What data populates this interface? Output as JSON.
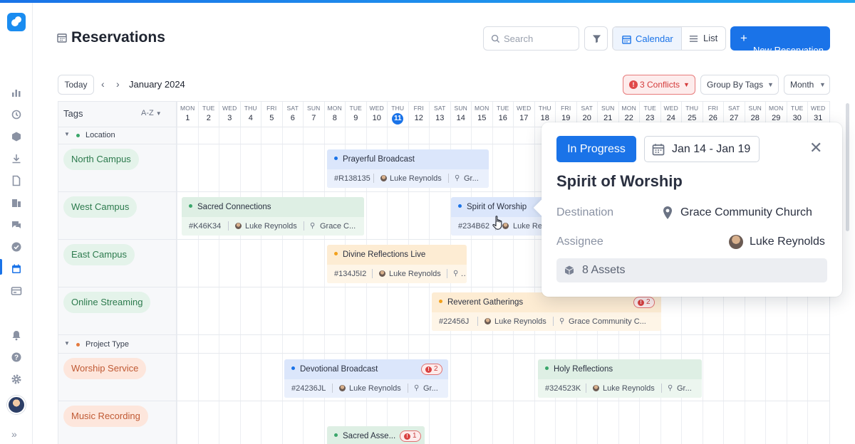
{
  "page": {
    "title": "Reservations"
  },
  "header": {
    "search_placeholder": "Search",
    "view_calendar_label": "Calendar",
    "view_list_label": "List",
    "new_reservation_label": "New Reservation"
  },
  "toolbar": {
    "today_label": "Today",
    "month_label": "January 2024",
    "conflicts_label": "3 Conflicts",
    "conflicts_icon_text": "!",
    "group_by_label": "Group By Tags",
    "range_label": "Month"
  },
  "grid": {
    "tags_header": "Tags",
    "sort_label": "A-Z",
    "today_day": 11,
    "days": [
      {
        "dow": "MON",
        "num": "1"
      },
      {
        "dow": "TUE",
        "num": "2"
      },
      {
        "dow": "WED",
        "num": "3"
      },
      {
        "dow": "THU",
        "num": "4"
      },
      {
        "dow": "FRI",
        "num": "5"
      },
      {
        "dow": "SAT",
        "num": "6"
      },
      {
        "dow": "SUN",
        "num": "7"
      },
      {
        "dow": "MON",
        "num": "8"
      },
      {
        "dow": "TUE",
        "num": "9"
      },
      {
        "dow": "WED",
        "num": "10"
      },
      {
        "dow": "THU",
        "num": "11"
      },
      {
        "dow": "FRI",
        "num": "12"
      },
      {
        "dow": "SAT",
        "num": "13"
      },
      {
        "dow": "SUN",
        "num": "14"
      },
      {
        "dow": "MON",
        "num": "15"
      },
      {
        "dow": "TUE",
        "num": "16"
      },
      {
        "dow": "WED",
        "num": "17"
      },
      {
        "dow": "THU",
        "num": "18"
      },
      {
        "dow": "FRI",
        "num": "19"
      },
      {
        "dow": "SAT",
        "num": "20"
      },
      {
        "dow": "SUN",
        "num": "21"
      },
      {
        "dow": "MON",
        "num": "22"
      },
      {
        "dow": "TUE",
        "num": "23"
      },
      {
        "dow": "WED",
        "num": "24"
      },
      {
        "dow": "THU",
        "num": "25"
      },
      {
        "dow": "FRI",
        "num": "26"
      },
      {
        "dow": "SAT",
        "num": "27"
      },
      {
        "dow": "SUN",
        "num": "28"
      },
      {
        "dow": "MON",
        "num": "29"
      },
      {
        "dow": "TUE",
        "num": "30"
      },
      {
        "dow": "WED",
        "num": "31"
      }
    ],
    "groups": [
      {
        "label": "Location",
        "color": "#3aa66a",
        "tags": [
          "North Campus",
          "West Campus",
          "East Campus",
          "Online Streaming"
        ]
      },
      {
        "label": "Project Type",
        "color": "#e47a3f",
        "tags": [
          "Worship Service",
          "Music Recording"
        ]
      }
    ]
  },
  "reservations": {
    "prayerful": {
      "title": "Prayerful Broadcast",
      "code": "#R138135",
      "person": "Luke Reynolds",
      "location": "Gr..."
    },
    "sacred": {
      "title": "Sacred Connections",
      "code": "#K46K34",
      "person": "Luke Reynolds",
      "location": "Grace C..."
    },
    "spirit": {
      "title": "Spirit of Worship",
      "code": "#234B62",
      "person": "Luke Re"
    },
    "divine": {
      "title": "Divine Reflections Live",
      "code": "#134J5I2",
      "person": "Luke Reynolds",
      "location": "..."
    },
    "reverent": {
      "title": "Reverent Gatherings",
      "code": "#22456J",
      "person": "Luke Reynolds",
      "location": "Grace Community C...",
      "conflicts": "2"
    },
    "devotional": {
      "title": "Devotional Broadcast",
      "code": "#24236JL",
      "person": "Luke Reynolds",
      "location": "Gr...",
      "conflicts": "2"
    },
    "holy": {
      "title": "Holy Reflections",
      "code": "#324523K",
      "person": "Luke Reynolds",
      "location": "Gr..."
    },
    "sacredasse": {
      "title": "Sacred Asse...",
      "conflicts": "1"
    }
  },
  "popover": {
    "status": "In Progress",
    "dates": "Jan 14 - Jan 19",
    "title": "Spirit of Worship",
    "destination_label": "Destination",
    "destination_value": "Grace Community Church",
    "assignee_label": "Assignee",
    "assignee_value": "Luke Reynolds",
    "assets_label": "8 Assets"
  },
  "colors": {
    "accent": "#1a73e8",
    "location_green": "#2c7a4d",
    "project_orange": "#c05a34",
    "conflict_red": "#d43b3b"
  }
}
